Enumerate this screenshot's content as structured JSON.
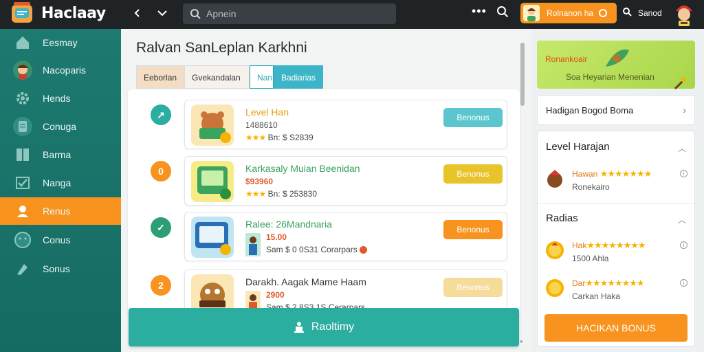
{
  "app": {
    "title": "Haclaay",
    "search_placeholder": "Apnein",
    "bonus_pill_label": "Rolnanon ha",
    "search_label": "Sanod"
  },
  "sidebar": {
    "items": [
      {
        "label": "Eesmay",
        "icon": "home-icon"
      },
      {
        "label": "Nacoparis",
        "icon": "profile-avatar-icon"
      },
      {
        "label": "Hends",
        "icon": "gear-icon"
      },
      {
        "label": "Conuga",
        "icon": "clipboard-icon"
      },
      {
        "label": "Barma",
        "icon": "book-icon"
      },
      {
        "label": "Nanga",
        "icon": "check-icon"
      },
      {
        "label": "Renus",
        "icon": "user-badge-icon",
        "active": true
      },
      {
        "label": "Conus",
        "icon": "face-icon"
      },
      {
        "label": "Sonus",
        "icon": "tag-icon"
      }
    ]
  },
  "main": {
    "title": "Ralvan SanLeplan Karkhni",
    "tabs": [
      "Eeborlan",
      "Gvekandalan",
      "Nan",
      "Badiarias"
    ],
    "cards": [
      {
        "marker": "↗",
        "title": "Level Han",
        "title_color": "#e6a21b",
        "sub": "1488610",
        "meta": "Bn: $ S2839",
        "button": "Benonus",
        "button_color": "#5cc6cf"
      },
      {
        "marker": "0",
        "title": "Karkasaly  Muian Beenidan",
        "title_color": "#3aa35c",
        "sub": "$93960",
        "meta": "Bn: $ 253830",
        "button": "Benonus",
        "button_color": "#e8c329"
      },
      {
        "marker": "✓",
        "title": "Ralee: 26Mandnaria",
        "title_color": "#3aa35c",
        "sub": "15.00",
        "meta": "Sam $ 0 0S31 Corarpars",
        "button": "Benonus",
        "button_color": "#f7931e"
      },
      {
        "marker": "2",
        "title": "Darakh. Aagak  Mame Haam",
        "title_color": "#e6a21b",
        "sub": "2900",
        "meta": "Sam $ 2 8S3 1S Cerarpars",
        "button": "Benonus",
        "button_color": "#f5dc9a"
      }
    ],
    "cta_label": "Raoltimy"
  },
  "right": {
    "promo_title": "Ronankoair",
    "promo_sub": "Soa Heyarian Menenian",
    "link_card": "Hadigan Bogod Boma",
    "sections": [
      {
        "title": "Level Harajan",
        "items": [
          {
            "name": "Hawan",
            "sub": "Ronekairo"
          }
        ]
      },
      {
        "title": "Radias",
        "items": [
          {
            "name": "Hak",
            "sub": "1500 Ahla"
          },
          {
            "name": "Dar",
            "sub": "Carkan Haka"
          }
        ]
      }
    ],
    "bonus_button": "HACIKAN BONUS"
  },
  "colors": {
    "accent_orange": "#f7931e",
    "sidebar_teal": "#1d7a70",
    "cta_teal": "#2bada0",
    "topbar_dark": "#1f2326"
  }
}
